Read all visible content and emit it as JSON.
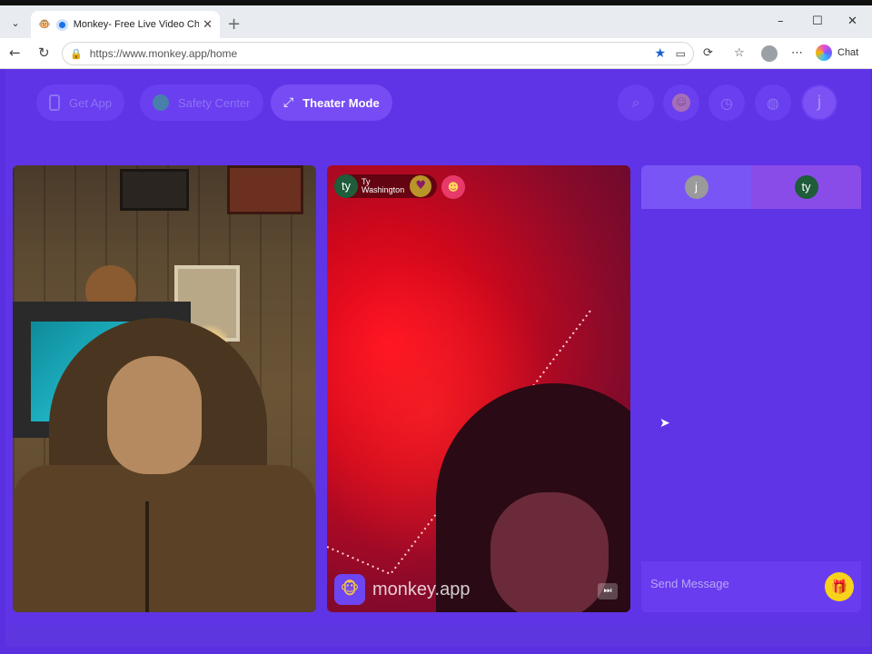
{
  "browser": {
    "tab_title": "Monkey- Free Live Video Cha",
    "tab_close": "✕",
    "new_tab": "+",
    "dropdown": "⌄",
    "url": "https://www.monkey.app/home",
    "chat_label": "Chat",
    "win_min": "–",
    "win_max": "☐",
    "win_close": "✕"
  },
  "nav": {
    "get_app": "Get App",
    "safety_center": "Safety Center",
    "theater_mode": "Theater Mode",
    "avatar_initial": "j"
  },
  "remote_user": {
    "initials": "ty",
    "first_name": "Ty",
    "last_name": "Washington"
  },
  "brand": {
    "name": "monkey.app"
  },
  "chat": {
    "tab1_initial": "j",
    "tab2_initial": "ty",
    "placeholder": "Send Message"
  }
}
